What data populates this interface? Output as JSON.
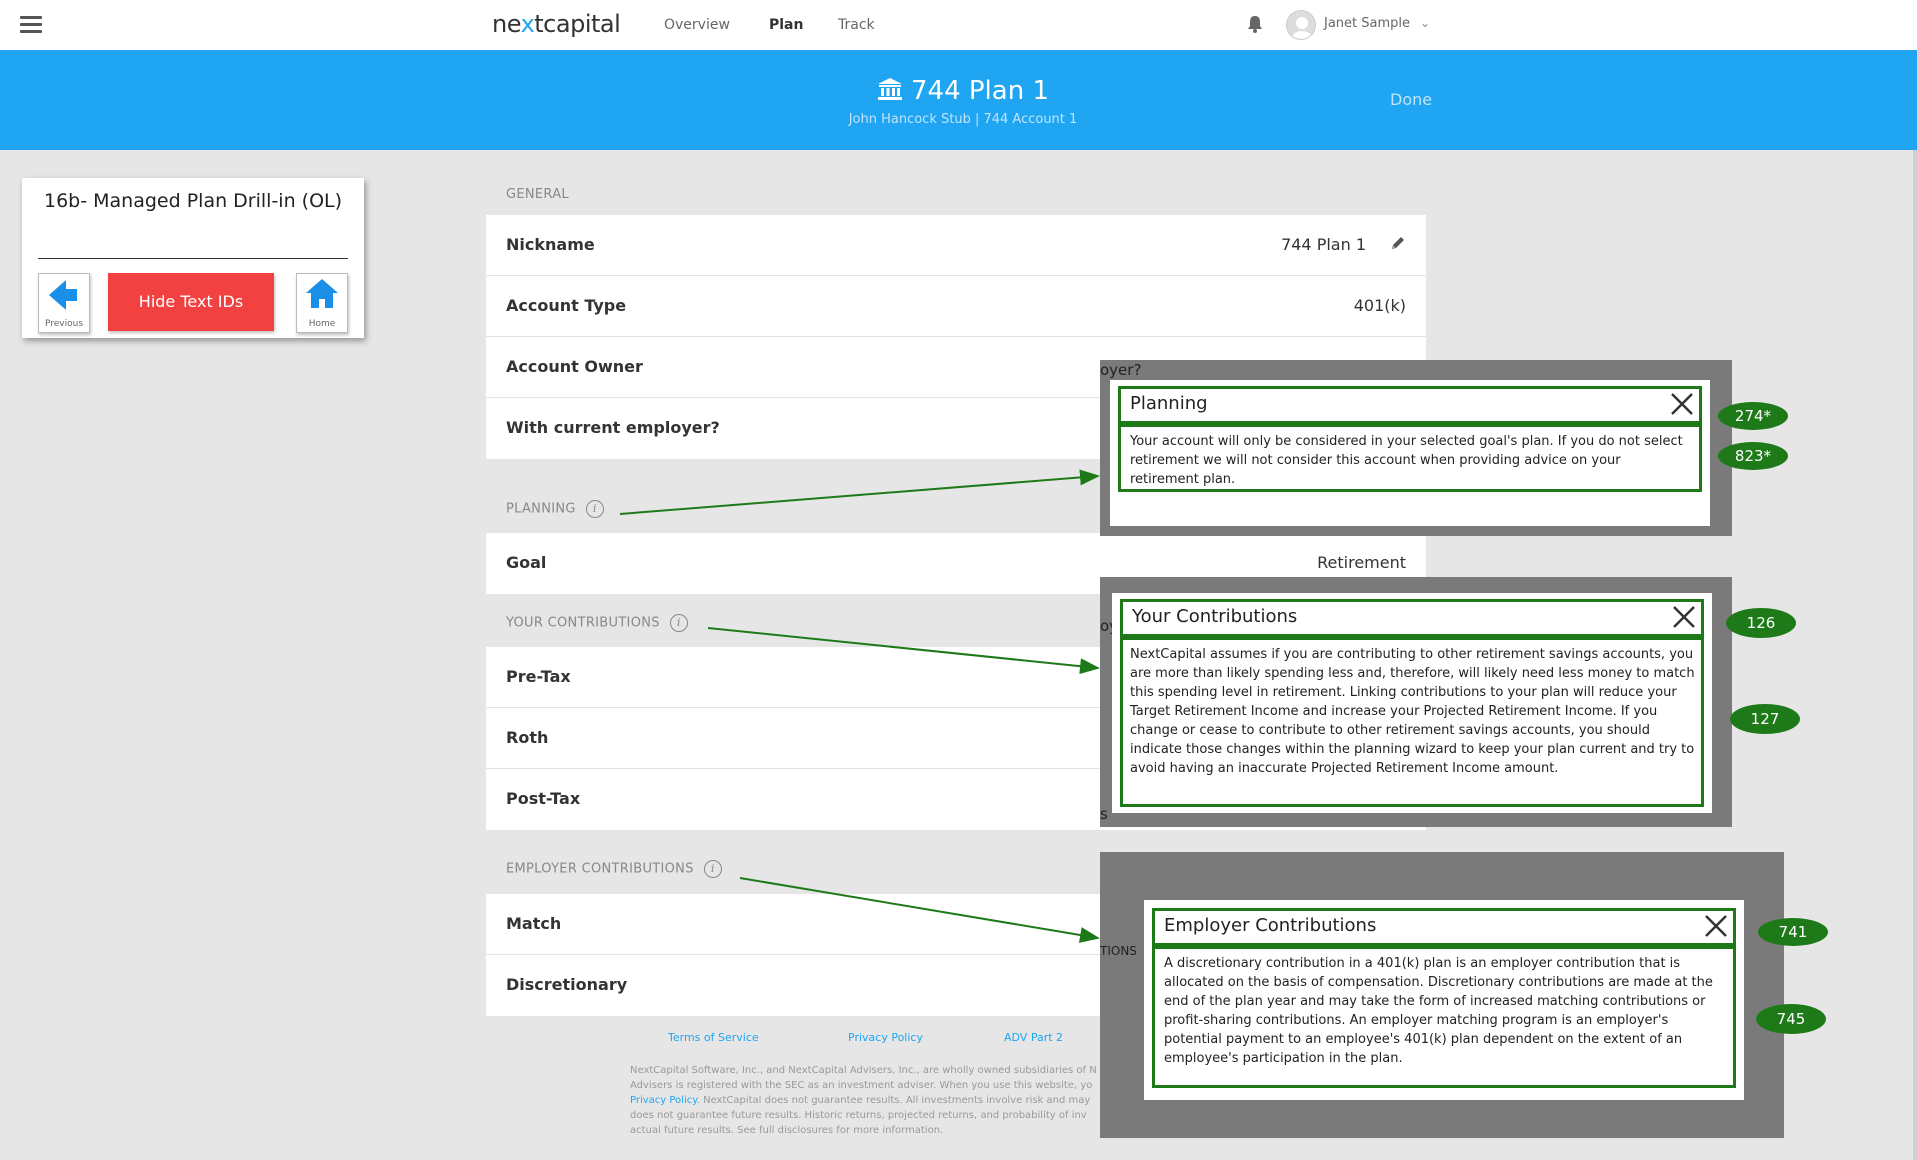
{
  "topnav": {
    "logo_pre": "ne",
    "logo_x": "x",
    "logo_post": "tcapital",
    "links": [
      "Overview",
      "Plan",
      "Track"
    ],
    "user": "Janet Sample"
  },
  "banner": {
    "title": "744 Plan 1",
    "subtitle": "John Hancock Stub | 744 Account 1",
    "done": "Done"
  },
  "idpanel": {
    "title": "16b- Managed Plan Drill-in (OL)",
    "previous": "Previous",
    "hide": "Hide Text IDs",
    "home": "Home"
  },
  "general": {
    "label": "GENERAL",
    "rows": [
      {
        "k": "Nickname",
        "v": "744 Plan 1"
      },
      {
        "k": "Account Type",
        "v": "401(k)"
      },
      {
        "k": "Account Owner",
        "v": ""
      },
      {
        "k": "With current employer?",
        "v": ""
      }
    ]
  },
  "planning": {
    "label": "PLANNING",
    "rows": [
      {
        "k": "Goal",
        "v": "Retirement"
      }
    ]
  },
  "your_contributions": {
    "label": "YOUR CONTRIBUTIONS",
    "rows": [
      {
        "k": "Pre-Tax"
      },
      {
        "k": "Roth"
      },
      {
        "k": "Post-Tax"
      }
    ]
  },
  "employer_contributions": {
    "label": "EMPLOYER CONTRIBUTIONS",
    "rows": [
      {
        "k": "Match"
      },
      {
        "k": "Discretionary"
      }
    ]
  },
  "footer": {
    "terms": "Terms of Service",
    "privacy": "Privacy Policy",
    "adv": "ADV Part 2",
    "line1": "NextCapital Software, Inc., and NextCapital Advisers, Inc., are wholly owned subsidiaries of N",
    "line2": "Advisers is registered with the SEC as an investment adviser. When you use this website, yo",
    "line3_link": "Privacy Policy",
    "line3_rest": ". NextCapital does not guarantee results. All investments involve risk and may",
    "line4": "does not guarantee future results. Historic returns, projected returns, and probability of inv",
    "line5": "actual future results. See full disclosures for more information."
  },
  "overlays": {
    "planning": {
      "clip": "oyer?",
      "title": "Planning",
      "body": "Your account will only be considered in your selected goal's plan. If you do not select retirement we will not consider this account when providing advice on your retirement plan.",
      "badges": [
        "274*",
        "823*"
      ]
    },
    "your_contributions": {
      "clip_top": "oy",
      "clip_bottom": "s",
      "title": "Your Contributions",
      "body": "NextCapital assumes if you are contributing to other retirement savings accounts, you are more than likely spending less and, therefore, will likely need less money to match this spending level in retirement. Linking contributions to your plan will reduce your Target Retirement Income and increase your Projected Retirement Income. If you change or cease to contribute to other retirement savings accounts, you should indicate those changes within the planning wizard to keep your plan current and try to avoid having an inaccurate Projected Retirement Income amount.",
      "badges": [
        "126",
        "127"
      ]
    },
    "employer_contributions": {
      "clip": "TIONS",
      "title": "Employer Contributions",
      "body": "A discretionary contribution in a 401(k) plan is an employer contribution that is allocated on the basis of compensation. Discretionary contributions are made at the end of the plan year and may take the form of increased matching contributions or profit-sharing contributions. An employer matching program is an employer's potential payment to an employee's 401(k) plan dependent on the extent of an employee's participation in the plan.",
      "badges": [
        "741",
        "745"
      ]
    }
  },
  "colors": {
    "brand_blue": "#1fa5f2",
    "annotation_green": "#1e7a18",
    "hide_red": "#f24141"
  },
  "icons": {
    "menu": "hamburger-icon",
    "bell": "bell-icon",
    "bank": "bank-icon",
    "pencil": "pencil-icon",
    "close": "close-icon",
    "info": "info-icon",
    "back": "arrow-left-icon",
    "home": "home-icon"
  }
}
